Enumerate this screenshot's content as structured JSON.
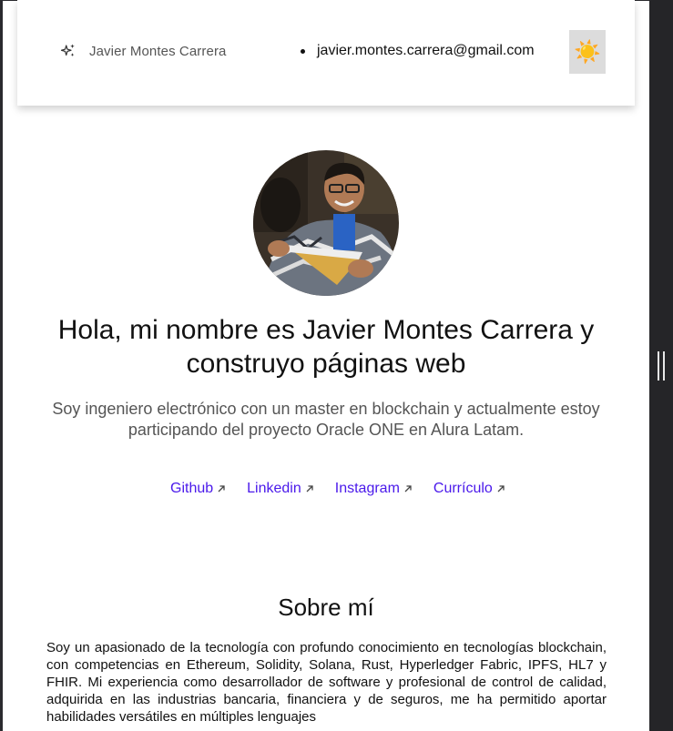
{
  "header": {
    "brand_icon": "sparkles-icon",
    "brand_name": "Javier Montes Carrera",
    "email": "javier.montes.carrera@gmail.com",
    "theme_toggle_icon": "sun-icon",
    "theme_toggle_glyph": "☀️"
  },
  "hero": {
    "title": "Hola, mi nombre es Javier Montes Carrera y construyo páginas web",
    "subtitle": "Soy ingeniero electrónico con un master en blockchain y actualmente estoy participando del proyecto Oracle ONE en Alura Latam.",
    "links": [
      {
        "label": "Github",
        "icon": "arrow-up-right-icon"
      },
      {
        "label": "Linkedin",
        "icon": "arrow-up-right-icon"
      },
      {
        "label": "Instagram",
        "icon": "arrow-up-right-icon"
      },
      {
        "label": "Currículo",
        "icon": "arrow-up-right-icon"
      }
    ]
  },
  "about": {
    "title": "Sobre mí",
    "text": "Soy un apasionado de la tecnología con profundo conocimiento en tecnologías blockchain, con competencias en Ethereum, Solidity, Solana, Rust, Hyperledger Fabric, IPFS, HL7 y FHIR. Mi experiencia como desarrollador de software y profesional de control de calidad, adquirida en las industrias bancaria, financiera y de seguros, me ha permitido aportar habilidades versátiles en múltiples lenguajes"
  },
  "colors": {
    "link": "#4b1aeb",
    "subtitle": "#555555",
    "scrollbar": "#252528"
  }
}
